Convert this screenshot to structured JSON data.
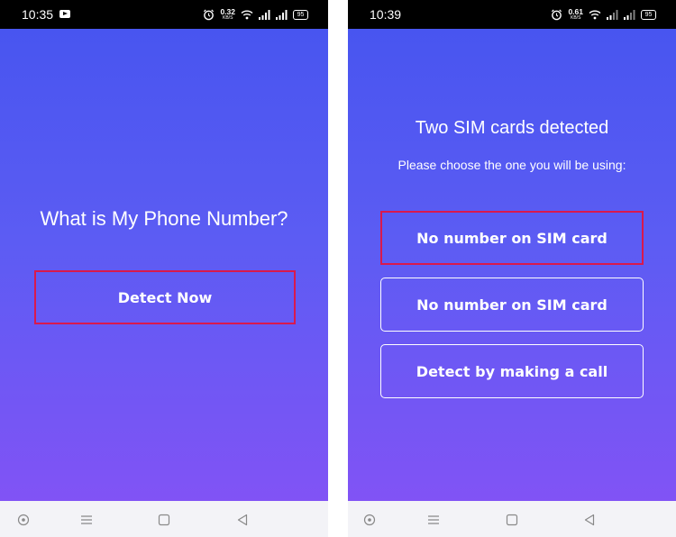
{
  "left_screen": {
    "status": {
      "time": "10:35",
      "speed_value": "0.32",
      "speed_unit": "KB/S",
      "battery": "95"
    },
    "title": "What is My Phone Number?",
    "detect_button": "Detect Now"
  },
  "right_screen": {
    "status": {
      "time": "10:39",
      "speed_value": "0.61",
      "speed_unit": "KB/S",
      "battery": "95"
    },
    "title": "Two SIM cards detected",
    "subtitle": "Please choose the one you will be using:",
    "options": [
      {
        "label": "No number on SIM card"
      },
      {
        "label": "No number on SIM card"
      },
      {
        "label": "Detect by making a call"
      }
    ]
  },
  "nav": {
    "icons": [
      "record-icon",
      "menu-icon",
      "home-square-icon",
      "back-triangle-icon"
    ]
  },
  "colors": {
    "gradient_top": "#4855f0",
    "gradient_bottom": "#8153f5",
    "highlight": "#d9194d",
    "status_bar": "#000000"
  }
}
